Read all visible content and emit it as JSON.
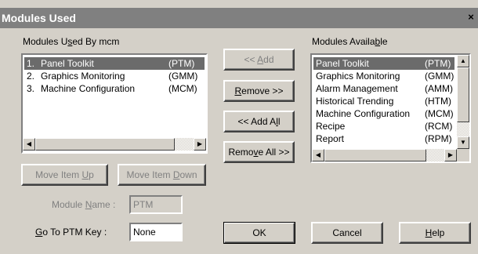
{
  "title": "Modules Used",
  "close_glyph": "×",
  "used": {
    "label_pre": "Modules U",
    "label_u": "s",
    "label_post": "ed By mcm",
    "items": [
      {
        "num": "1.",
        "name": "Panel Toolkit",
        "code": "(PTM)"
      },
      {
        "num": "2.",
        "name": "Graphics Monitoring",
        "code": "(GMM)"
      },
      {
        "num": "3.",
        "name": "Machine Configuration",
        "code": "(MCM)"
      }
    ]
  },
  "available": {
    "label_pre": "Modules Availa",
    "label_u": "b",
    "label_post": "le",
    "items": [
      {
        "name": "Panel Toolkit",
        "code": "(PTM)"
      },
      {
        "name": "Graphics Monitoring",
        "code": "(GMM)"
      },
      {
        "name": "Alarm Management",
        "code": "(AMM)"
      },
      {
        "name": "Historical Trending",
        "code": "(HTM)"
      },
      {
        "name": "Machine Configuration",
        "code": "(MCM)"
      },
      {
        "name": "Recipe",
        "code": "(RCM)"
      },
      {
        "name": "Report",
        "code": "(RPM)"
      }
    ]
  },
  "buttons": {
    "add_pre": "<< ",
    "add_u": "A",
    "add_post": "dd",
    "remove_pre": "",
    "remove_u": "R",
    "remove_post": "emove >>",
    "add_all_pre": "<< Add A",
    "add_all_u": "l",
    "add_all_post": "l",
    "remove_all_pre": "Remo",
    "remove_all_u": "v",
    "remove_all_post": "e All >>",
    "move_up_pre": "Move Item ",
    "move_up_u": "U",
    "move_up_post": "p",
    "move_down_pre": "Move Item ",
    "move_down_u": "D",
    "move_down_post": "own",
    "ok": "OK",
    "cancel": "Cancel",
    "help_pre": "",
    "help_u": "H",
    "help_post": "elp"
  },
  "module_name": {
    "label_pre": "Module ",
    "label_u": "N",
    "label_post": "ame :",
    "value": "PTM"
  },
  "goto_key": {
    "label_pre": "",
    "label_u": "G",
    "label_post": "o To PTM Key :",
    "value": "None"
  }
}
